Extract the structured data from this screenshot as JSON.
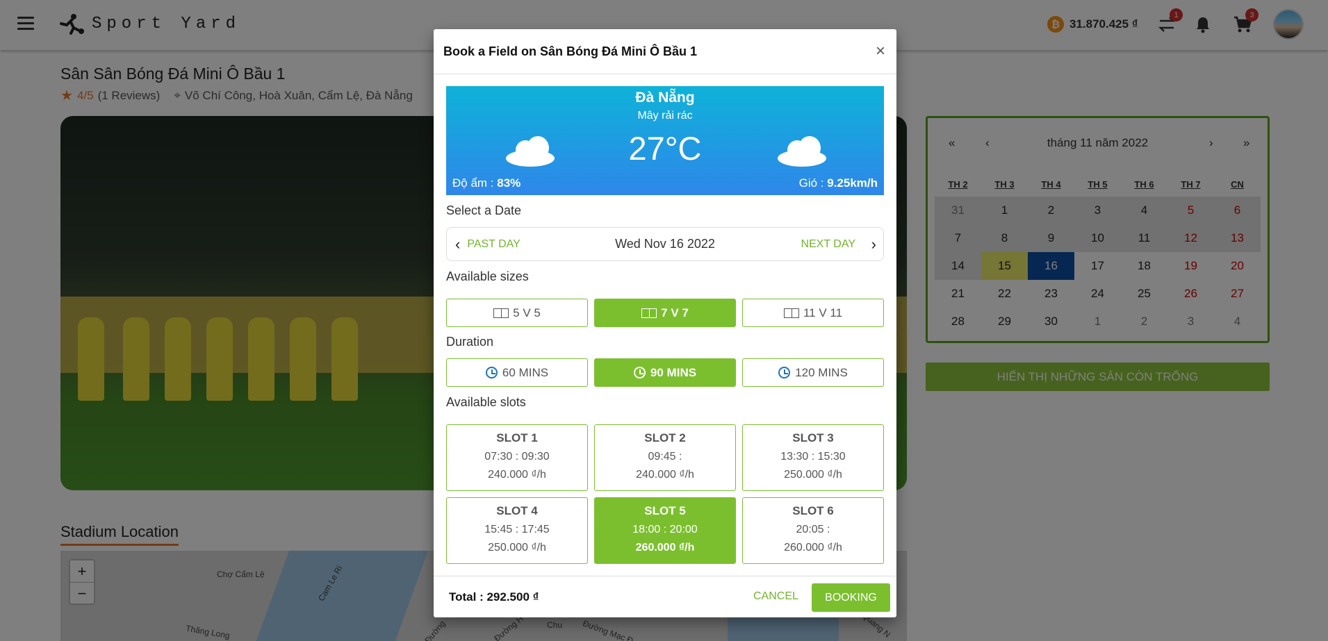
{
  "header": {
    "app_name": "Sport Yard",
    "balance": "31.870.425 ₫",
    "coin_symbol": "₿",
    "transfer_badge": "1",
    "cart_badge": "3",
    "icons": [
      "menu-icon",
      "logo-icon",
      "coin-icon",
      "transfer-icon",
      "bell-icon",
      "cart-icon"
    ]
  },
  "page": {
    "title": "Sân Sân Bóng Đá Mini Ô Bầu 1",
    "rating": "4/5",
    "reviews": "(1 Reviews)",
    "address": "Võ Chí Công, Hoà Xuân, Cẩm Lệ, Đà Nẵng",
    "location_title": "Stadium Location",
    "map_labels": [
      "Chợ Cẩm Lệ",
      "Cam Le Ri",
      "Đường",
      "Chu",
      "Đường Mạc Đ",
      "Quang N",
      "Thăng Long",
      "Đường H"
    ]
  },
  "calendar": {
    "month_label": "tháng 11 năm 2022",
    "nav": {
      "prev_year": "«",
      "prev": "‹",
      "next": "›",
      "next_year": "»"
    },
    "weekdays": [
      "TH 2",
      "TH 3",
      "TH 4",
      "TH 5",
      "TH 6",
      "TH 7",
      "CN"
    ],
    "weeks": [
      [
        "31",
        "1",
        "2",
        "3",
        "4",
        "5",
        "6"
      ],
      [
        "7",
        "8",
        "9",
        "10",
        "11",
        "12",
        "13"
      ],
      [
        "14",
        "15",
        "16",
        "17",
        "18",
        "19",
        "20"
      ],
      [
        "21",
        "22",
        "23",
        "24",
        "25",
        "26",
        "27"
      ],
      [
        "28",
        "29",
        "30",
        "1",
        "2",
        "3",
        "4"
      ]
    ],
    "today": "15",
    "selected": "16",
    "show_button": "HIỂN THỊ NHỮNG SÂN CÒN TRỐNG"
  },
  "modal": {
    "title": "Book a Field on Sân Bóng Đá Mini Ô Bầu 1",
    "close": "×",
    "weather": {
      "city": "Đà Nẵng",
      "desc": "Mây rải rác",
      "temp": "27°C",
      "humidity_label": "Độ ẩm : ",
      "humidity": "83%",
      "wind_label": "Gió : ",
      "wind": "9.25km/h"
    },
    "select_date_label": "Select a Date",
    "past_day": "PAST DAY",
    "current_date": "Wed Nov 16 2022",
    "next_day": "NEXT DAY",
    "sizes_label": "Available sizes",
    "sizes": [
      {
        "label": "5 V 5",
        "selected": false
      },
      {
        "label": "7 V 7",
        "selected": true
      },
      {
        "label": "11 V 11",
        "selected": false
      }
    ],
    "duration_label": "Duration",
    "durations": [
      {
        "label": "60 MINS",
        "selected": false
      },
      {
        "label": "90 MINS",
        "selected": true
      },
      {
        "label": "120 MINS",
        "selected": false
      }
    ],
    "slots_label": "Available slots",
    "slots": [
      {
        "name": "SLOT 1",
        "time": "07:30 : 09:30",
        "price": "240.000 ₫/h",
        "selected": false
      },
      {
        "name": "SLOT 2",
        "time": "09:45 :",
        "price": "240.000 ₫/h",
        "selected": false
      },
      {
        "name": "SLOT 3",
        "time": "13:30 : 15:30",
        "price": "250.000 ₫/h",
        "selected": false
      },
      {
        "name": "SLOT 4",
        "time": "15:45 : 17:45",
        "price": "250.000 ₫/h",
        "selected": false
      },
      {
        "name": "SLOT 5",
        "time": "18:00 : 20:00",
        "price": "260.000 ₫/h",
        "selected": true
      },
      {
        "name": "SLOT 6",
        "time": "20:05 :",
        "price": "260.000 ₫/h",
        "selected": false
      }
    ],
    "total": "Total : 292.500 ₫",
    "cancel": "CANCEL",
    "booking": "BOOKING"
  },
  "colors": {
    "accent": "#7bbf2f",
    "danger": "#d32f2f",
    "selected_date": "#0e4fa6",
    "today": "#ecec6b"
  }
}
